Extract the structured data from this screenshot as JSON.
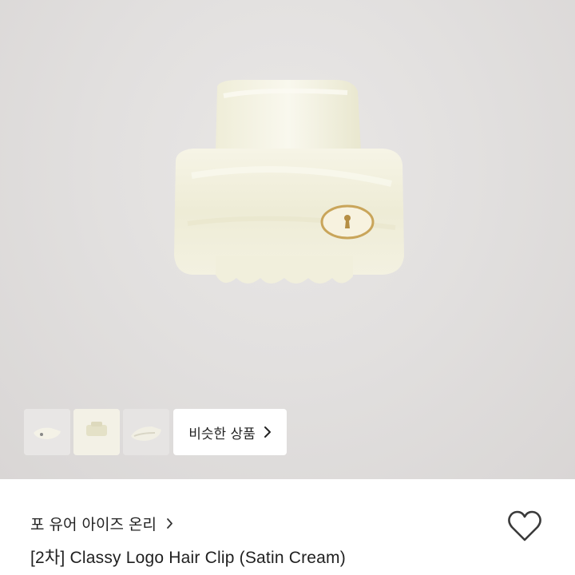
{
  "gallery": {
    "similar_button_label": "비슷한 상품",
    "thumbnails": [
      "thumbnail-1",
      "thumbnail-2",
      "thumbnail-3"
    ]
  },
  "shop": {
    "name": "포 유어 아이즈 온리"
  },
  "product": {
    "title": "[2차] Classy Logo Hair Clip (Satin Cream)"
  },
  "icons": {
    "shop_chevron": "chevron-right-icon",
    "similar_chevron": "chevron-right-icon",
    "wishlist": "heart-outline-icon"
  },
  "colors": {
    "hero_bg": "#e2e0df",
    "clip_cream": "#f1efdc",
    "text_primary": "#222222",
    "heart_stroke": "#3a3a3a"
  }
}
